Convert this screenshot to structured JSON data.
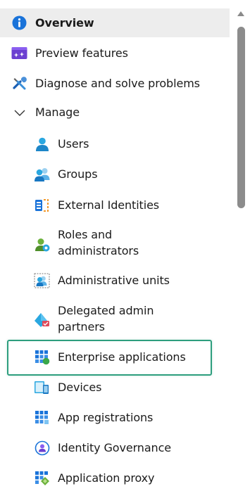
{
  "nav": {
    "overview": {
      "label": "Overview",
      "icon": "info-icon",
      "selected": true
    },
    "preview_features": {
      "label": "Preview features",
      "icon": "preview-features-icon"
    },
    "diagnose": {
      "label": "Diagnose and solve problems",
      "icon": "tools-icon"
    },
    "manage": {
      "label": "Manage",
      "icon": "chevron-down-icon",
      "expanded": true
    },
    "children": {
      "users": {
        "label": "Users",
        "icon": "user-icon"
      },
      "groups": {
        "label": "Groups",
        "icon": "groups-icon"
      },
      "external_identities": {
        "label": "External Identities",
        "icon": "external-identities-icon"
      },
      "roles": {
        "label": "Roles and administrators",
        "icon": "roles-icon"
      },
      "admin_units": {
        "label": "Administrative units",
        "icon": "administrative-units-icon"
      },
      "delegated": {
        "label": "Delegated admin partners",
        "icon": "delegated-admin-icon"
      },
      "enterprise_apps": {
        "label": "Enterprise applications",
        "icon": "enterprise-apps-icon",
        "highlighted": true
      },
      "devices": {
        "label": "Devices",
        "icon": "devices-icon"
      },
      "app_registrations": {
        "label": "App registrations",
        "icon": "app-registrations-icon"
      },
      "identity_governance": {
        "label": "Identity Governance",
        "icon": "identity-governance-icon"
      },
      "application_proxy": {
        "label": "Application proxy",
        "icon": "application-proxy-icon"
      }
    }
  },
  "colors": {
    "selected_bg": "#ededed",
    "highlight_border": "#2e9e7e",
    "azure_blue": "#0078d4",
    "scrollbar_thumb": "#8c8c8c"
  }
}
